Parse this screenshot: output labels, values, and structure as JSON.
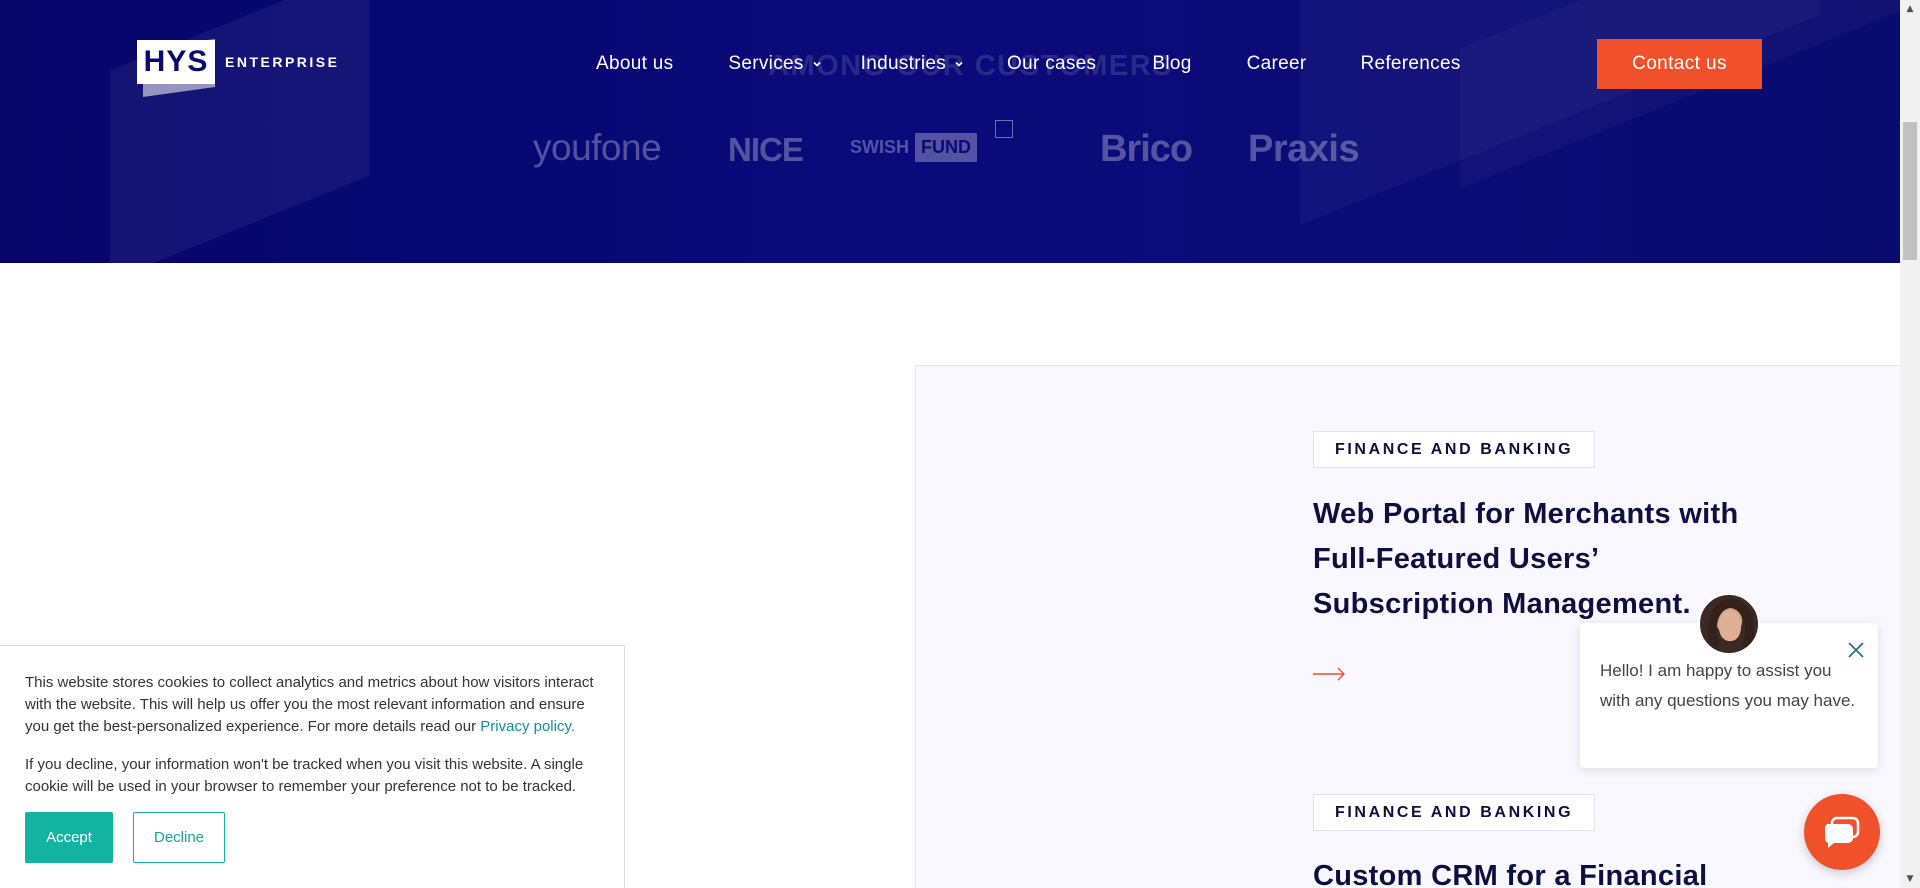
{
  "brand": {
    "logo_mark": "HYS",
    "logo_word": "ENTERPRISE"
  },
  "nav": {
    "items": [
      {
        "label": "About us",
        "has_dropdown": false
      },
      {
        "label": "Services",
        "has_dropdown": true
      },
      {
        "label": "Industries",
        "has_dropdown": true
      },
      {
        "label": "Our cases",
        "has_dropdown": false
      },
      {
        "label": "Blog",
        "has_dropdown": false
      },
      {
        "label": "Career",
        "has_dropdown": false
      },
      {
        "label": "References",
        "has_dropdown": false
      }
    ],
    "contact_label": "Contact us"
  },
  "customers": {
    "title": "AMONG OUR CUSTOMERS",
    "logos": [
      "youfone",
      "NICE",
      "SWISH",
      "FUND",
      "Brico",
      "Praxis"
    ]
  },
  "cases": [
    {
      "tag": "FINANCE AND BANKING",
      "title": "Web Portal for Merchants with Full-Featured Users’ Subscription Management."
    },
    {
      "tag": "FINANCE AND BANKING",
      "title": "Custom CRM for a Financial"
    }
  ],
  "cookie": {
    "text1": "This website stores cookies to collect analytics and metrics about how visitors interact with the website. This will help us offer you the most relevant information and ensure you get the best-personalized experience. For more details read our",
    "privacy_link": "Privacy policy.",
    "text2": "If you decline, your information won't be tracked when you visit this website. A single cookie will be used in your browser to remember your preference not to be tracked.",
    "accept_label": "Accept",
    "decline_label": "Decline"
  },
  "chat": {
    "message": "Hello! I am happy to assist you with any questions you may have."
  },
  "colors": {
    "hero_bg": "#0a0a78",
    "accent": "#f0512b",
    "cookie_accent": "#13b3a1",
    "text_dark": "#0d0f3f",
    "card_bg": "#f8f8fe"
  },
  "icons": [
    "chevron-down-icon",
    "arrow-right-icon",
    "close-icon",
    "chat-icon",
    "broken-image-icon",
    "scroll-up-icon",
    "scroll-down-icon"
  ]
}
